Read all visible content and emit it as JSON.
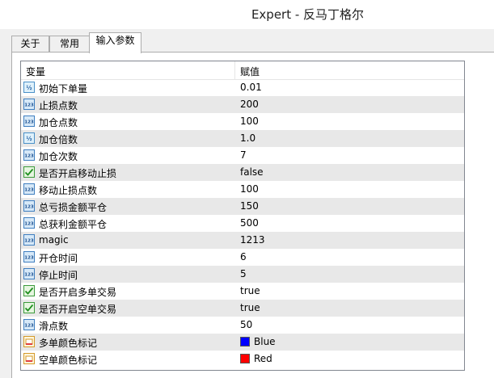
{
  "window": {
    "title": "Expert - 反马丁格尔"
  },
  "tabs": [
    {
      "label": "关于",
      "active": false
    },
    {
      "label": "常用",
      "active": false
    },
    {
      "label": "输入参数",
      "active": true
    }
  ],
  "table": {
    "headers": {
      "variable": "变量",
      "value": "赋值"
    },
    "rows": [
      {
        "icon": "double-icon",
        "name": "初始下单量",
        "value": "0.01"
      },
      {
        "icon": "integer-icon",
        "name": "止损点数",
        "value": "200"
      },
      {
        "icon": "integer-icon",
        "name": "加仓点数",
        "value": "100"
      },
      {
        "icon": "double-icon",
        "name": "加仓倍数",
        "value": "1.0"
      },
      {
        "icon": "integer-icon",
        "name": "加仓次数",
        "value": "7"
      },
      {
        "icon": "bool-icon",
        "name": "是否开启移动止损",
        "value": "false"
      },
      {
        "icon": "integer-icon",
        "name": "移动止损点数",
        "value": "100"
      },
      {
        "icon": "integer-icon",
        "name": "总亏损金额平仓",
        "value": "150"
      },
      {
        "icon": "integer-icon",
        "name": "总获利金额平仓",
        "value": "500"
      },
      {
        "icon": "integer-icon",
        "name": "magic",
        "value": "1213"
      },
      {
        "icon": "integer-icon",
        "name": "开仓时间",
        "value": "6"
      },
      {
        "icon": "integer-icon",
        "name": "停止时间",
        "value": "5"
      },
      {
        "icon": "bool-icon",
        "name": "是否开启多单交易",
        "value": "true"
      },
      {
        "icon": "bool-icon",
        "name": "是否开启空单交易",
        "value": "true"
      },
      {
        "icon": "integer-icon",
        "name": "滑点数",
        "value": "50"
      },
      {
        "icon": "color-icon",
        "name": "多单颜色标记",
        "value": "Blue",
        "swatch": "#0000ff"
      },
      {
        "icon": "color-icon",
        "name": "空单颜色标记",
        "value": "Red",
        "swatch": "#ff0000"
      }
    ]
  }
}
